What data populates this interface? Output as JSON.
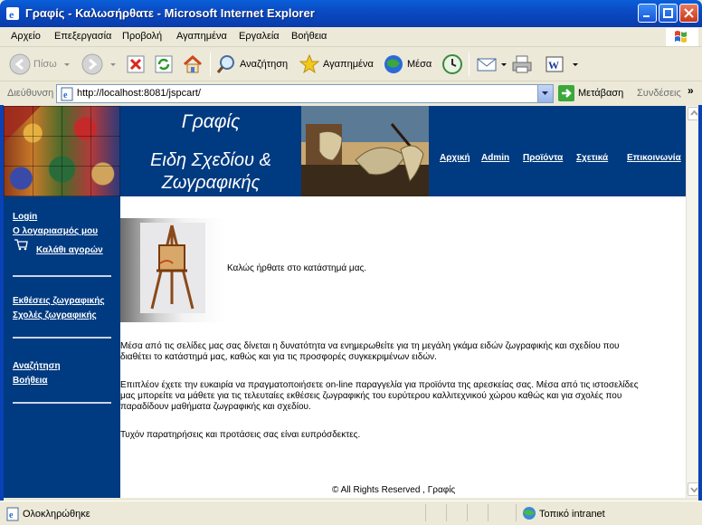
{
  "window": {
    "title": "Γραφίς - Καλωσήρθατε - Microsoft Internet Explorer"
  },
  "menu": [
    "Αρχείο",
    "Επεξεργασία",
    "Προβολή",
    "Αγαπημένα",
    "Εργαλεία",
    "Βοήθεια"
  ],
  "toolbar": {
    "back_label": "Πίσω",
    "search_label": "Αναζήτηση",
    "favorites_label": "Αγαπημένα",
    "media_label": "Μέσα"
  },
  "address": {
    "label": "Διεύθυνση",
    "url": "http://localhost:8081/jspcart/",
    "go_label": "Μετάβαση",
    "links_label": "Συνδέσεις"
  },
  "site": {
    "title": "Γραφίς",
    "subtitle_line1": "Ειδη Σχεδίου &",
    "subtitle_line2": "Ζωγραφικής",
    "nav": [
      "Αρχική",
      "Admin",
      "Προϊόντα",
      "Σχετικά",
      "Επικοινωνία"
    ],
    "sidebar": {
      "login": "Login",
      "account": "Ο λογαριασμός μου",
      "cart": "Καλάθι αγορών",
      "exhibitions": "Εκθέσεις ζωγραφικής",
      "schools": "Σχολές ζωγραφικής",
      "search": "Αναζήτηση",
      "help": "Βοήθεια"
    },
    "welcome": "Καλώς ήρθατε στο κατάστημά μας.",
    "paragraph1_line1": "Μέσα από τις σελίδες μας σας δίνεται η δυνατότητα να ενημερωθείτε για τη μεγάλη γκάμα ειδών ζωγραφικής και σχεδίου που",
    "paragraph1_line2": "διαθέτει το κατάστημά μας, καθώς και για τις προσφορές συγκεκριμένων ειδών.",
    "paragraph2_line1": "Επιπλέον έχετε την ευκαιρία να πραγματοποιήσετε on-line παραγγελία για προϊόντα της αρεσκείας σας. Μέσα από τις ιστοσελίδες",
    "paragraph2_line2": "μας μπορείτε να μάθετε για τις τελευταίες εκθέσεις ζωγραφικής του ευρύτερου καλλιτεχνικού χώρου καθώς και για σχολές που",
    "paragraph2_line3": "παραδίδουν μαθήματα ζωγραφικής και σχεδίου.",
    "paragraph3": "Τυχόν παρατηρήσεις και προτάσεις σας είναι ευπρόσδεκτες.",
    "footer": "© All Rights Reserved , Γραφίς"
  },
  "status": {
    "text": "Ολοκληρώθηκε",
    "zone": "Τοπικό intranet"
  },
  "colors": {
    "site_blue": "#003a80",
    "xp_title_blue": "#0a4bc4"
  }
}
